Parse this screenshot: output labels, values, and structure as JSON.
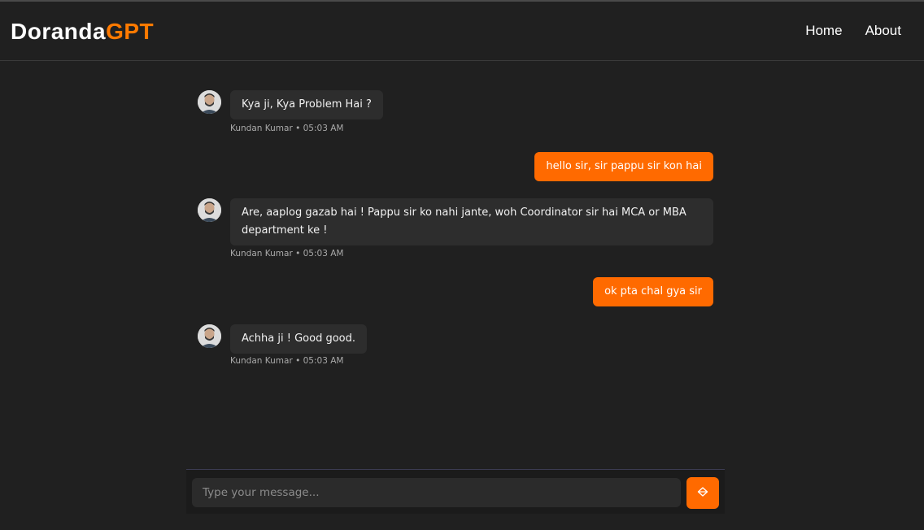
{
  "brand": {
    "part1": "Doranda",
    "part2": "GPT"
  },
  "nav": {
    "home": "Home",
    "about": "About"
  },
  "messages": [
    {
      "sender": "bot",
      "text": "Kya ji, Kya Problem Hai ?",
      "meta": "Kundan Kumar • 05:03 AM"
    },
    {
      "sender": "user",
      "text": "hello sir, sir pappu sir kon hai"
    },
    {
      "sender": "bot",
      "text": "Are, aaplog gazab hai ! Pappu sir ko nahi jante, woh Coordinator sir hai MCA or MBA department ke !",
      "meta": "Kundan Kumar • 05:03 AM"
    },
    {
      "sender": "user",
      "text": "ok pta chal gya sir"
    },
    {
      "sender": "bot",
      "text": "Achha ji ! Good good.",
      "meta": "Kundan Kumar • 05:03 AM"
    }
  ],
  "composer": {
    "placeholder": "Type your message..."
  },
  "colors": {
    "accent": "#ff6a00",
    "brand_accent": "#ff7a00",
    "background": "#202020",
    "bot_bubble": "#2d2d2d"
  },
  "icons": {
    "send": "send-icon",
    "avatar": "avatar-icon"
  }
}
